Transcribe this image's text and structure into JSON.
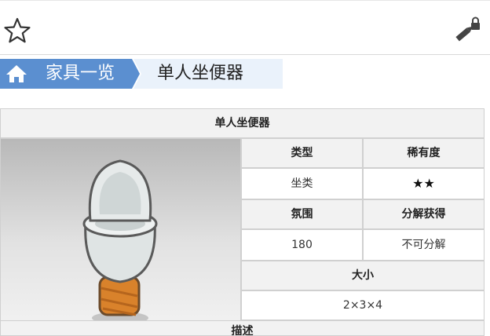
{
  "toolbar": {
    "favorite_icon": "star-outline-icon",
    "edit_icon": "locked-edit-icon"
  },
  "breadcrumb": {
    "home_icon": "home-icon",
    "parent_label": "家具一览",
    "current_label": "单人坐便器"
  },
  "infobox": {
    "title": "单人坐便器",
    "image_alt": "toilet",
    "type_header": "类型",
    "type_value": "坐类",
    "rarity_header": "稀有度",
    "rarity_value": "★★",
    "ambience_header": "氛围",
    "ambience_value": "180",
    "decompose_header": "分解获得",
    "decompose_value": "不可分解",
    "size_header": "大小",
    "size_value": "2×3×4",
    "description_header": "描述"
  },
  "colors": {
    "breadcrumb_accent": "#5b8fd0",
    "breadcrumb_current_bg": "#eaf2fb",
    "table_header_bg": "#f2f2f2",
    "border": "#d0d0d0",
    "rope": "#d9822b"
  }
}
